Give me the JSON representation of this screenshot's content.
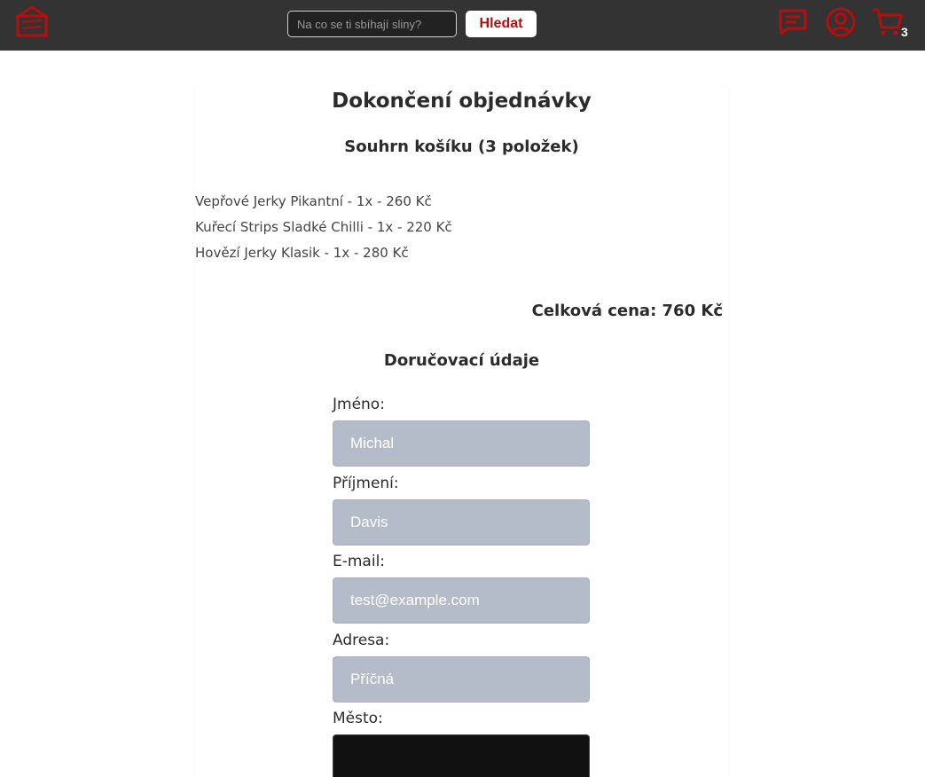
{
  "header": {
    "search": {
      "placeholder": "Na co se ti sbíhají sliny?",
      "value": ""
    },
    "search_button": "Hledat",
    "cart_count": "3",
    "accent_color": "#b30f0f",
    "icons": [
      "logo-icon",
      "chat-icon",
      "user-icon",
      "cart-icon"
    ]
  },
  "order": {
    "title": "Dokončení objednávky",
    "summary_title": "Souhrn košíku (3 položek)",
    "items": [
      "Vepřové Jerky Pikantní - 1x - 260 Kč",
      "Kuřecí Strips Sladké Chilli - 1x - 220 Kč",
      "Hovězí Jerky Klasik - 1x - 280 Kč"
    ],
    "total": "Celková cena: 760 Kč"
  },
  "delivery": {
    "title": "Doručovací údaje",
    "fields": [
      {
        "label": "Jméno:",
        "value": "Michal"
      },
      {
        "label": "Příjmení:",
        "value": "Davis"
      },
      {
        "label": "E-mail:",
        "value": "test@example.com"
      },
      {
        "label": "Adresa:",
        "value": "Příčná"
      },
      {
        "label": "Město:",
        "value": ""
      }
    ]
  }
}
